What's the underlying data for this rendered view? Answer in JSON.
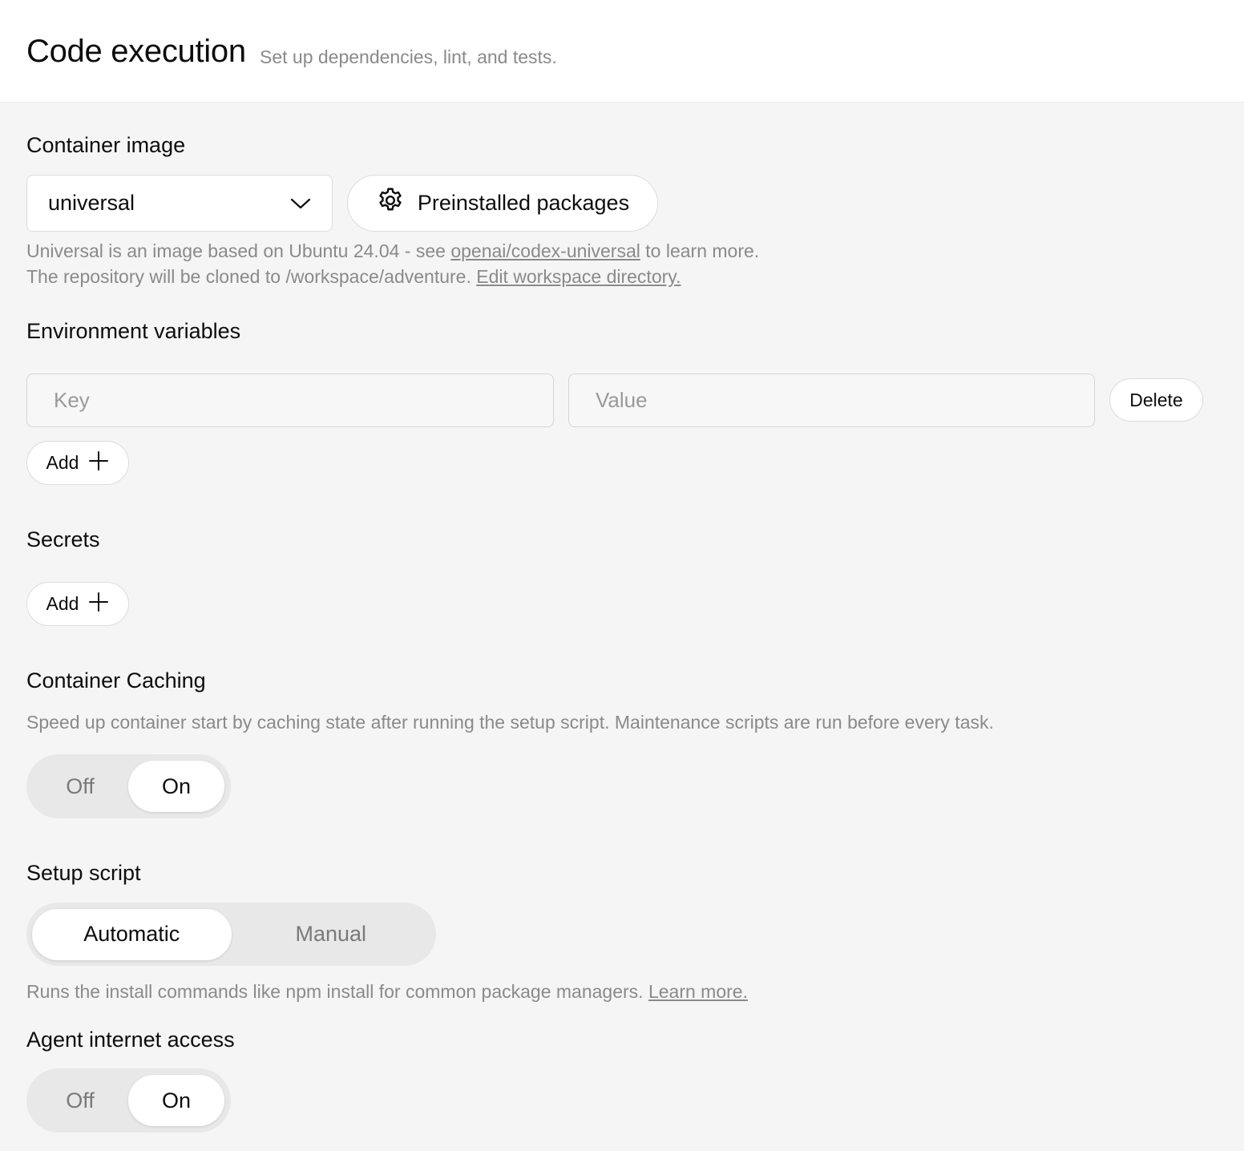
{
  "header": {
    "title": "Code execution",
    "subtitle": "Set up dependencies, lint, and tests."
  },
  "container_image": {
    "label": "Container image",
    "selected": "universal",
    "packages_button": "Preinstalled packages",
    "help_prefix": "Universal is an image based on Ubuntu 24.04 - see ",
    "help_link": "openai/codex-universal",
    "help_suffix": " to learn more.",
    "clone_text": "The repository will be cloned to /workspace/adventure. ",
    "clone_link": "Edit workspace directory."
  },
  "env_vars": {
    "label": "Environment variables",
    "key_placeholder": "Key",
    "value_placeholder": "Value",
    "delete_label": "Delete",
    "add_label": "Add"
  },
  "secrets": {
    "label": "Secrets",
    "add_label": "Add"
  },
  "caching": {
    "label": "Container Caching",
    "description": "Speed up container start by caching state after running the setup script. Maintenance scripts are run before every task.",
    "off_label": "Off",
    "on_label": "On",
    "value": "On"
  },
  "setup_script": {
    "label": "Setup script",
    "automatic_label": "Automatic",
    "manual_label": "Manual",
    "selected": "Automatic",
    "help_text": "Runs the install commands like npm install for common package managers. ",
    "help_link": "Learn more."
  },
  "internet": {
    "label": "Agent internet access",
    "off_label": "Off",
    "on_label": "On",
    "value": "On"
  }
}
